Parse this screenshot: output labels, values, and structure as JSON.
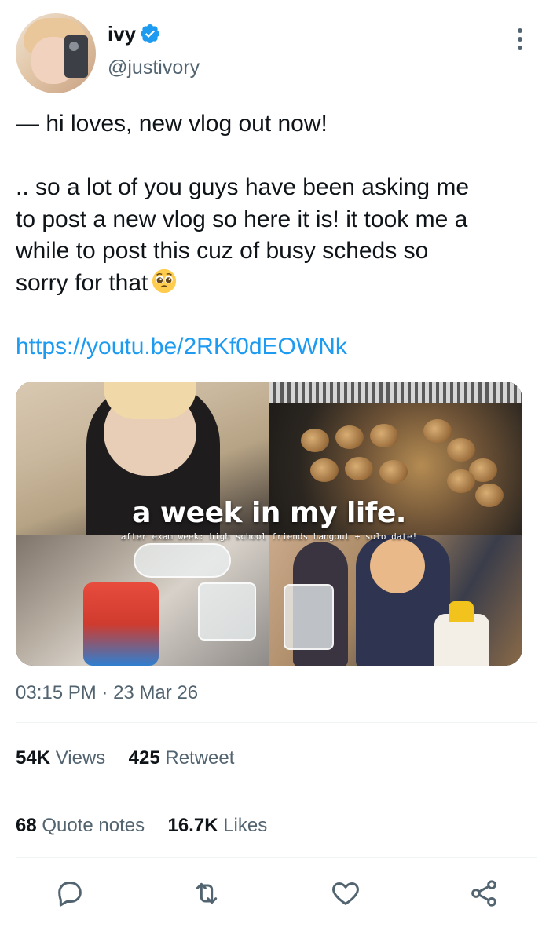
{
  "user": {
    "name": "ivy",
    "handle": "@justivory",
    "verified_badge_color": "#1d9bf0",
    "icons": {
      "verified": "verified-badge-icon",
      "more": "more-options-icon"
    }
  },
  "tweet": {
    "line1": "— hi loves, new vlog out now!",
    "para_lines": [
      ".. so a lot of you guys have been asking me",
      "to post a new vlog so here it is! it took me a",
      "while to post this cuz of busy scheds so",
      "sorry for that"
    ],
    "emoji": "pleading-face-emoji",
    "link": "https://youtu.be/2RKf0dEOWNk",
    "link_color": "#1d9bf0"
  },
  "media": {
    "title": "a week in my life.",
    "subtitle": "after exam week: high school friends hangout + solo date!"
  },
  "meta": {
    "time": "03:15 PM",
    "separator": "·",
    "date": "23 Mar 26"
  },
  "stats": {
    "views_count": "54K",
    "views_label": "Views",
    "retweets_count": "425",
    "retweets_label": "Retweet",
    "quotes_count": "68",
    "quotes_label": "Quote notes",
    "likes_count": "16.7K",
    "likes_label": "Likes"
  },
  "actions": [
    "reply-icon",
    "retweet-icon",
    "like-icon",
    "share-icon"
  ],
  "colors": {
    "text": "#0f1419",
    "secondary": "#536471",
    "divider": "#eff3f4"
  }
}
